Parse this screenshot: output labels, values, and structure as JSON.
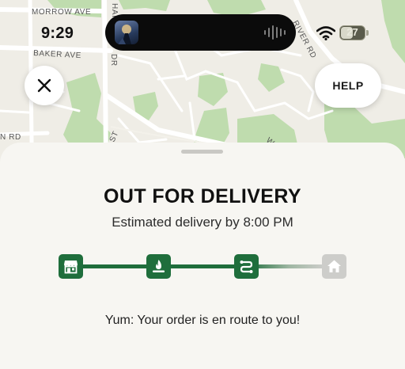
{
  "status_bar": {
    "time": "9:29",
    "battery_level": "27",
    "wifi_icon": "wifi-icon",
    "now_playing_icon": "album-art-icon",
    "audio_icon": "waveform-icon"
  },
  "map": {
    "streets": [
      "MORROW AVE",
      "BAKER AVE",
      "RIVER RD",
      "N RD",
      "ST",
      "HAR",
      "DR",
      "W"
    ]
  },
  "header": {
    "close_icon": "close-icon",
    "help_label": "HELP"
  },
  "order": {
    "status_title": "OUT FOR DELIVERY",
    "estimate": "Estimated delivery by 8:00 PM",
    "message": "Yum: Your order is en route to you!",
    "steps": [
      {
        "icon": "store-icon",
        "state": "complete"
      },
      {
        "icon": "fire-icon",
        "state": "complete"
      },
      {
        "icon": "route-icon",
        "state": "complete"
      },
      {
        "icon": "home-icon",
        "state": "pending"
      }
    ],
    "colors": {
      "complete": "#1f6e3c",
      "pending": "#cdcdca"
    }
  }
}
